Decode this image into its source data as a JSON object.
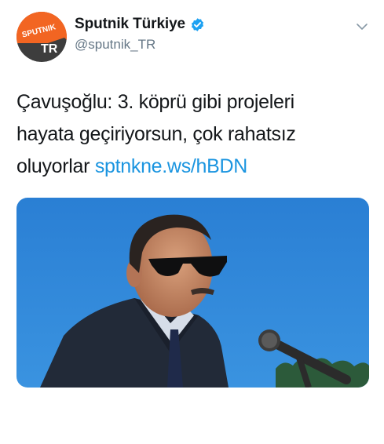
{
  "account": {
    "display_name": "Sputnik Türkiye",
    "handle": "@sputnik_TR",
    "verified": true,
    "avatar": {
      "logo_text": "SPUTNIK",
      "country_code": "TR",
      "colors": {
        "orange": "#f26522",
        "dark": "#3d3d3d",
        "white": "#ffffff"
      }
    }
  },
  "tweet": {
    "text_line_1": "Çavuşoğlu: 3. köprü gibi projeleri",
    "text_line_2": "hayata geçiriyorsun, çok rahatsız",
    "text_line_3_prefix": "oluyorlar ",
    "link": "sptnkne.ws/hBDN"
  },
  "media": {
    "type": "photo",
    "description_icon": "photo-of-speaker-with-sunglasses-at-microphone"
  },
  "colors": {
    "text": "#14171a",
    "secondary": "#657786",
    "link": "#1b95e0",
    "verified": "#1da1f2",
    "sky": "#2f86d6"
  },
  "icons": {
    "verified": "verified-badge-icon",
    "menu": "chevron-down-icon"
  }
}
